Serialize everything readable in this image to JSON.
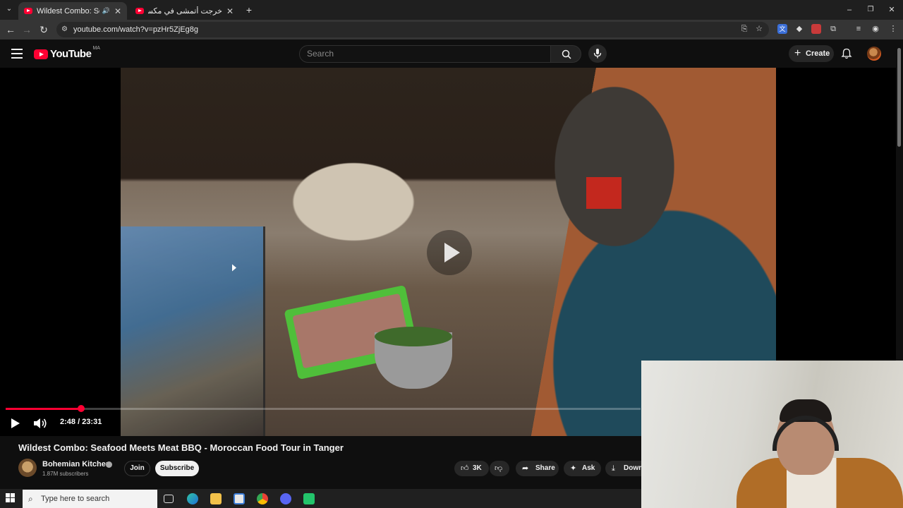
{
  "browser": {
    "tabs": [
      {
        "title": "Wildest Combo: Seafood M",
        "active": true
      },
      {
        "title": "خرجت أتمشى في مكسيكو... ولعد",
        "active": false
      }
    ],
    "new_tab": "+",
    "url": "youtube.com/watch?v=pzHr5ZjEg8g",
    "window_controls": [
      "–",
      "❐",
      "✕"
    ]
  },
  "youtube": {
    "logo_text": "YouTube",
    "country_code": "MA",
    "search_placeholder": "Search",
    "create_label": "Create"
  },
  "player": {
    "time": "2:48 / 23:31",
    "progress_fraction": 0.119,
    "state": "paused"
  },
  "video": {
    "title": "Wildest Combo: Seafood Meets Meat BBQ - Moroccan Food Tour in Tanger",
    "channel": "Bohemian Kitchen",
    "subscribers": "1.87M subscribers",
    "join_label": "Join",
    "subscribe_label": "Subscribe",
    "like_count": "3K",
    "share_label": "Share",
    "ask_label": "Ask",
    "download_label": "Download"
  },
  "taskbar": {
    "search_placeholder": "Type here to search"
  },
  "colors": {
    "brand_red": "#ff0033",
    "background": "#0f0f0f",
    "pill": "#272727"
  }
}
